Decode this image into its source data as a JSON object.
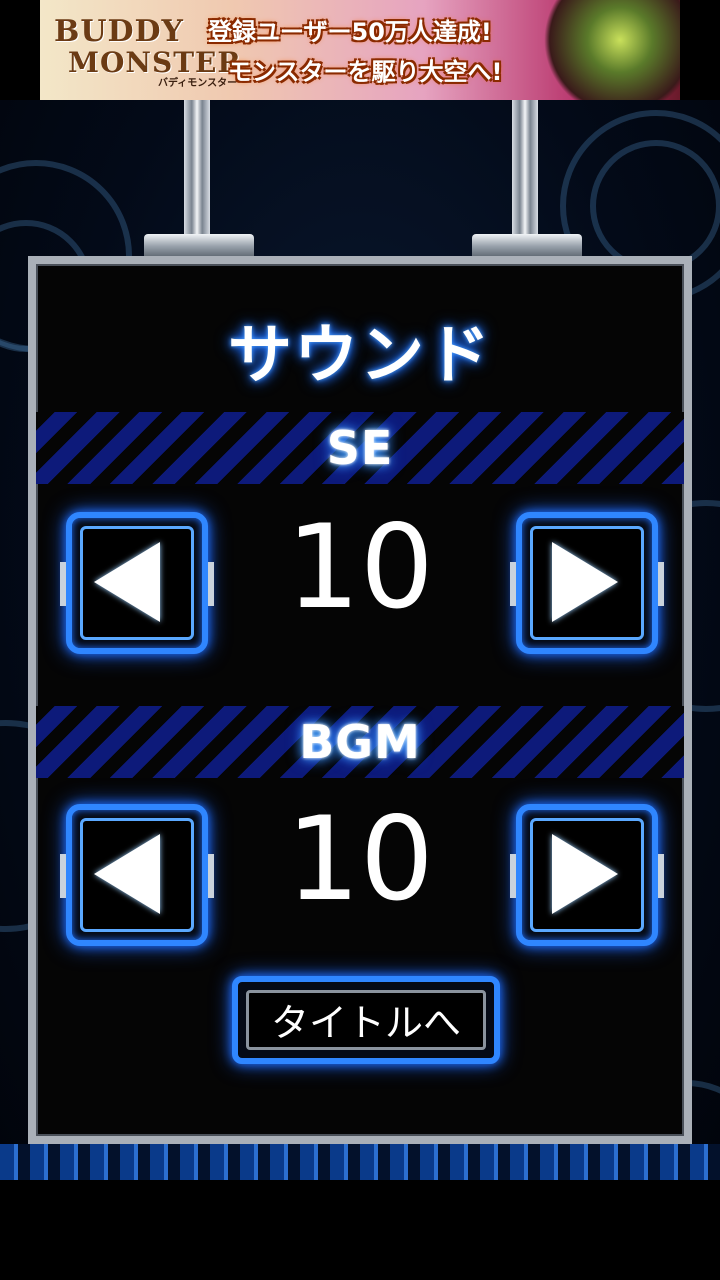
{
  "ad": {
    "logo_line1": "BUDDY",
    "logo_line2": "MONSTER",
    "logo_sub": "バディモンスター",
    "headline": "登録ユーザー50万人達成!",
    "subline": "モンスターを駆り大空へ!"
  },
  "panel": {
    "title": "サウンド",
    "se": {
      "label": "SE",
      "value": "10"
    },
    "bgm": {
      "label": "BGM",
      "value": "10"
    },
    "back_button_label": "タイトルへ"
  },
  "colors": {
    "accent_blue": "#2f86ff",
    "stripe_blue": "#0d1a7a",
    "frame_silver": "#aab0b8"
  },
  "icons": {
    "decrease": "left-triangle-icon",
    "increase": "right-triangle-icon"
  }
}
